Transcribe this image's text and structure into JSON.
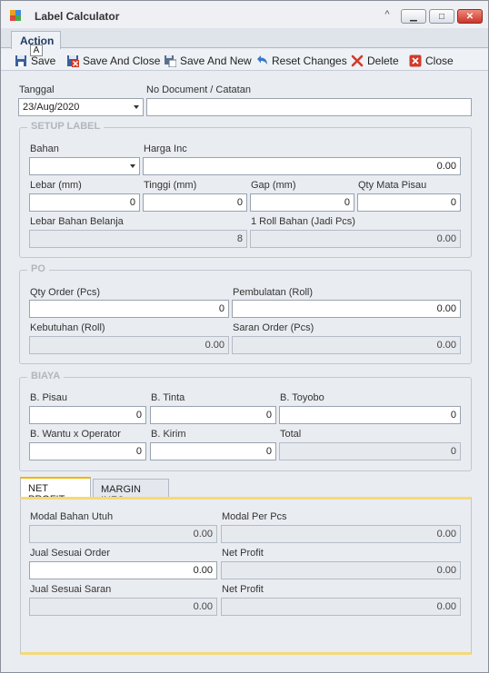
{
  "window": {
    "title": "Label Calculator",
    "minimize_glyph": "▁",
    "maximize_glyph": "□",
    "close_glyph": "✕",
    "collapse_glyph": "^"
  },
  "ribbon": {
    "tab_label": "Action",
    "keytip": "A"
  },
  "toolbar": {
    "save": "Save",
    "save_close": "Save And Close",
    "save_new": "Save And New",
    "reset": "Reset Changes",
    "delete": "Delete",
    "close": "Close"
  },
  "header": {
    "tanggal_label": "Tanggal",
    "tanggal_value": "23/Aug/2020",
    "nodoc_label": "No Document / Catatan",
    "nodoc_value": ""
  },
  "setup": {
    "title": "SETUP LABEL",
    "bahan_label": "Bahan",
    "bahan_value": "",
    "harga_label": "Harga Inc",
    "harga_value": "0.00",
    "lebar_label": "Lebar (mm)",
    "lebar_value": "0",
    "tinggi_label": "Tinggi (mm)",
    "tinggi_value": "0",
    "gap_label": "Gap (mm)",
    "gap_value": "0",
    "qty_pisau_label": "Qty Mata Pisau",
    "qty_pisau_value": "0",
    "lebar_belanja_label": "Lebar Bahan Belanja",
    "lebar_belanja_value": "8",
    "roll_label": "1 Roll Bahan (Jadi Pcs)",
    "roll_value": "0.00"
  },
  "po": {
    "title": "PO",
    "qty_order_label": "Qty Order (Pcs)",
    "qty_order_value": "0",
    "pembulatan_label": "Pembulatan (Roll)",
    "pembulatan_value": "0.00",
    "kebutuhan_label": "Kebutuhan (Roll)",
    "kebutuhan_value": "0.00",
    "saran_label": "Saran Order (Pcs)",
    "saran_value": "0.00"
  },
  "biaya": {
    "title": "BIAYA",
    "pisau_label": "B. Pisau",
    "pisau_value": "0",
    "tinta_label": "B. Tinta",
    "tinta_value": "0",
    "toyobo_label": "B. Toyobo",
    "toyobo_value": "0",
    "wantu_label": "B. Wantu x Operator",
    "wantu_value": "0",
    "kirim_label": "B. Kirim",
    "kirim_value": "0",
    "total_label": "Total",
    "total_value": "0"
  },
  "tabs": {
    "net_profit": "NET PROFIT",
    "margin_info": "MARGIN INFO"
  },
  "profit": {
    "modal_utuh_label": "Modal Bahan Utuh",
    "modal_utuh_value": "0.00",
    "modal_pcs_label": "Modal Per Pcs",
    "modal_pcs_value": "0.00",
    "jual_order_label": "Jual Sesuai Order",
    "jual_order_value": "0.00",
    "net_profit1_label": "Net Profit",
    "net_profit1_value": "0.00",
    "jual_saran_label": "Jual Sesuai Saran",
    "jual_saran_value": "0.00",
    "net_profit2_label": "Net Profit",
    "net_profit2_value": "0.00"
  }
}
